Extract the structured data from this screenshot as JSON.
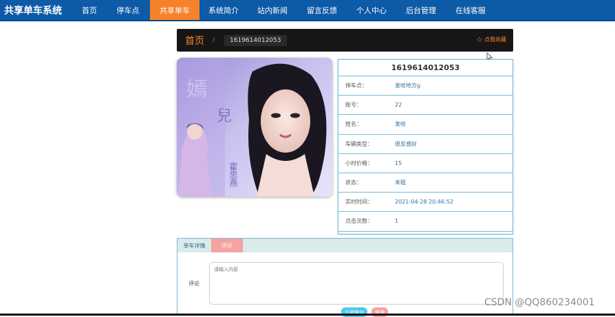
{
  "nav": {
    "brand": "共享单车系统",
    "items": [
      {
        "label": "首页",
        "active": false
      },
      {
        "label": "停车点",
        "active": false
      },
      {
        "label": "共享单车",
        "active": true
      },
      {
        "label": "系统简介",
        "active": false
      },
      {
        "label": "站内新闻",
        "active": false
      },
      {
        "label": "留言反馈",
        "active": false
      },
      {
        "label": "个人中心",
        "active": false
      },
      {
        "label": "后台管理",
        "active": false
      },
      {
        "label": "在线客服",
        "active": false
      }
    ]
  },
  "breadcrumb": {
    "home": "首页",
    "separator": "/",
    "current": "1619614012053",
    "favorite_label": "点我收藏"
  },
  "detail": {
    "title": "1619614012053",
    "rows": [
      {
        "key": "停车点：",
        "value": "发哈地方g"
      },
      {
        "key": "账号：",
        "value": "22"
      },
      {
        "key": "姓名：",
        "value": "发哈"
      },
      {
        "key": "车辆类型：",
        "value": "很反感好"
      },
      {
        "key": "小时价格：",
        "value": "15"
      },
      {
        "key": "状态：",
        "value": "未租"
      },
      {
        "key": "实时时间：",
        "value": "2021-04-28 20:46:52"
      },
      {
        "key": "点击次数：",
        "value": "1"
      }
    ]
  },
  "tabs": {
    "details_label": "单车详情",
    "comment_label": "评论"
  },
  "comment": {
    "label": "评论",
    "placeholder": "请输入内容",
    "submit_label": "立即提交",
    "reset_label": "重置"
  },
  "watermark": "CSDN @QQ860234001",
  "colors": {
    "nav_bg": "#0d5aa7",
    "accent": "#f5822a",
    "border": "#7ab8d6",
    "tab_active": "#f4a39e",
    "submit": "#4fc9ea"
  }
}
